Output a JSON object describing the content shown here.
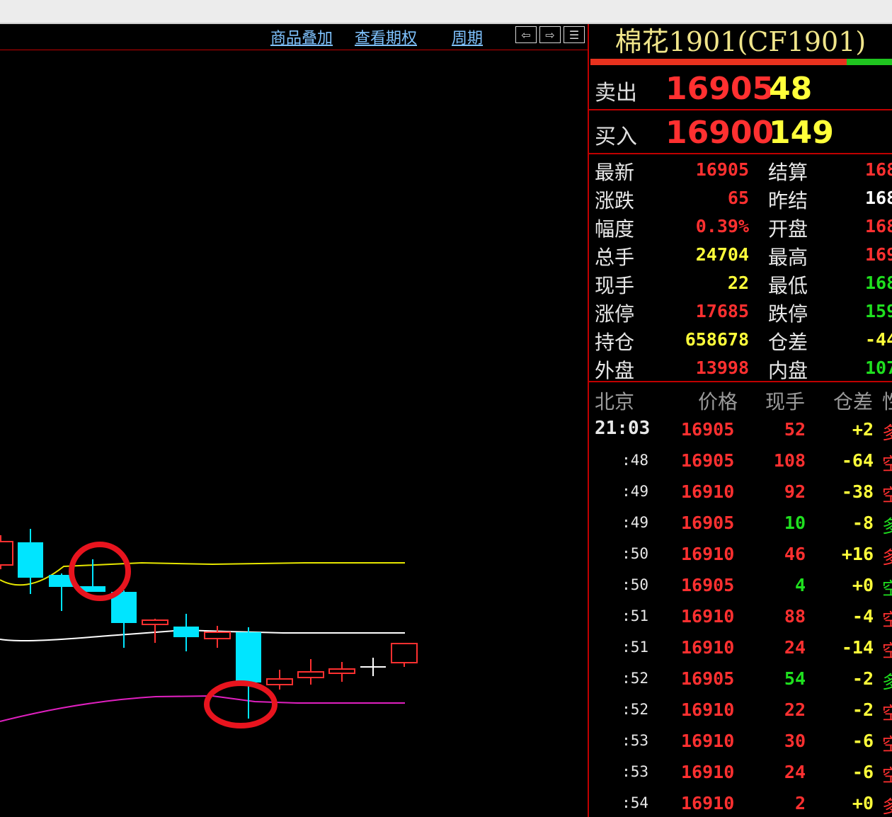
{
  "toolbar": {
    "links": [
      "商品叠加",
      "查看期权",
      "周期"
    ],
    "buttons": [
      {
        "icon": "arrow-left-icon",
        "glyph": "⇦"
      },
      {
        "icon": "arrow-right-icon",
        "glyph": "⇨"
      },
      {
        "icon": "panel-toggle-icon",
        "glyph": "☰"
      }
    ]
  },
  "colors": {
    "up": "#ff3030",
    "down": "#00e5ff",
    "green": "#1fe01f",
    "yellow": "#ffff3a",
    "ma_yellow": "#e6e600",
    "ma_white": "#ffffff",
    "ma_magenta": "#e020c0",
    "marker": "#e8141e"
  },
  "quote": {
    "title": "棉花1901(CF1901)",
    "sell_ratio": 0.85,
    "ask": {
      "label": "卖出",
      "price": "16905",
      "volume": "48"
    },
    "bid": {
      "label": "买入",
      "price": "16900",
      "volume": "149"
    },
    "rows": [
      {
        "l1": "最新",
        "v1": "16905",
        "c1": "up",
        "l2": "结算",
        "v2": "168",
        "c2": "up"
      },
      {
        "l1": "涨跌",
        "v1": "65",
        "c1": "up",
        "l2": "昨结",
        "v2": "168",
        "c2": "white"
      },
      {
        "l1": "幅度",
        "v1": "0.39%",
        "c1": "up",
        "l2": "开盘",
        "v2": "168",
        "c2": "up"
      },
      {
        "l1": "总手",
        "v1": "24704",
        "c1": "yellow",
        "l2": "最高",
        "v2": "169",
        "c2": "up"
      },
      {
        "l1": "现手",
        "v1": "22",
        "c1": "yellow",
        "l2": "最低",
        "v2": "168",
        "c2": "green"
      },
      {
        "l1": "涨停",
        "v1": "17685",
        "c1": "up",
        "l2": "跌停",
        "v2": "159",
        "c2": "green"
      },
      {
        "l1": "持仓",
        "v1": "658678",
        "c1": "yellow",
        "l2": "仓差",
        "v2": "-44",
        "c2": "yellow"
      },
      {
        "l1": "外盘",
        "v1": "13998",
        "c1": "up",
        "l2": "内盘",
        "v2": "107",
        "c2": "green"
      }
    ]
  },
  "ticks": {
    "headers": [
      "北京",
      "价格",
      "现手",
      "仓差",
      "性"
    ],
    "rows": [
      {
        "time": "21:03",
        "price": "16905",
        "vol": "52",
        "vc": "up",
        "oi": "+2",
        "oc": "yellow",
        "nat": "多",
        "nc": "up"
      },
      {
        "time": ":48",
        "price": "16905",
        "vol": "108",
        "vc": "up",
        "oi": "-64",
        "oc": "yellow",
        "nat": "空",
        "nc": "up"
      },
      {
        "time": ":49",
        "price": "16910",
        "vol": "92",
        "vc": "up",
        "oi": "-38",
        "oc": "yellow",
        "nat": "空",
        "nc": "up"
      },
      {
        "time": ":49",
        "price": "16905",
        "vol": "10",
        "vc": "green",
        "oi": "-8",
        "oc": "yellow",
        "nat": "多",
        "nc": "green"
      },
      {
        "time": ":50",
        "price": "16910",
        "vol": "46",
        "vc": "up",
        "oi": "+16",
        "oc": "yellow",
        "nat": "多",
        "nc": "up"
      },
      {
        "time": ":50",
        "price": "16905",
        "vol": "4",
        "vc": "green",
        "oi": "+0",
        "oc": "yellow",
        "nat": "空",
        "nc": "green"
      },
      {
        "time": ":51",
        "price": "16910",
        "vol": "88",
        "vc": "up",
        "oi": "-4",
        "oc": "yellow",
        "nat": "空",
        "nc": "up"
      },
      {
        "time": ":51",
        "price": "16910",
        "vol": "24",
        "vc": "up",
        "oi": "-14",
        "oc": "yellow",
        "nat": "空",
        "nc": "up"
      },
      {
        "time": ":52",
        "price": "16905",
        "vol": "54",
        "vc": "green",
        "oi": "-2",
        "oc": "yellow",
        "nat": "多",
        "nc": "green"
      },
      {
        "time": ":52",
        "price": "16910",
        "vol": "22",
        "vc": "up",
        "oi": "-2",
        "oc": "yellow",
        "nat": "空",
        "nc": "up"
      },
      {
        "time": ":53",
        "price": "16910",
        "vol": "30",
        "vc": "up",
        "oi": "-6",
        "oc": "yellow",
        "nat": "空",
        "nc": "up"
      },
      {
        "time": ":53",
        "price": "16910",
        "vol": "24",
        "vc": "up",
        "oi": "-6",
        "oc": "yellow",
        "nat": "空",
        "nc": "up"
      },
      {
        "time": ":54",
        "price": "16910",
        "vol": "2",
        "vc": "up",
        "oi": "+0",
        "oc": "yellow",
        "nat": "多",
        "nc": "up"
      }
    ]
  }
}
